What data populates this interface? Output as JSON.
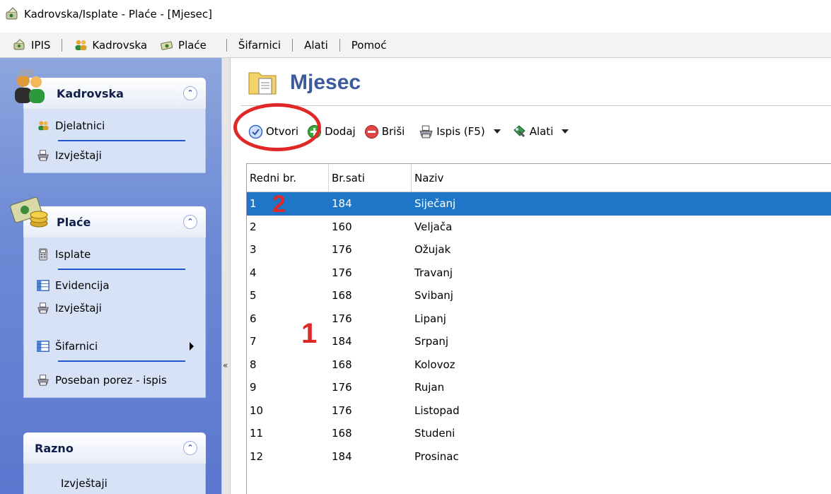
{
  "window": {
    "title": "Kadrovska/Isplate - Plaće - [Mjesec]"
  },
  "menu": {
    "items": [
      {
        "label": "IPIS",
        "icon": "ipis-icon"
      },
      {
        "label": "Kadrovska",
        "icon": "users-icon"
      },
      {
        "label": "Plaće",
        "icon": "money-icon"
      },
      {
        "label": "Šifarnici"
      },
      {
        "label": "Alati"
      },
      {
        "label": "Pomoć"
      }
    ]
  },
  "sidebar": {
    "groups": [
      {
        "title": "Kadrovska",
        "icon": "users-group-icon",
        "items": [
          {
            "label": "Djelatnici",
            "icon": "users-icon"
          },
          {
            "label": "Izvještaji",
            "icon": "printer-icon"
          }
        ]
      },
      {
        "title": "Plaće",
        "icon": "money-coins-icon",
        "items": [
          {
            "label": "Isplate",
            "icon": "calculator-icon"
          },
          {
            "label": "Evidencija",
            "icon": "table-icon"
          },
          {
            "label": "Izvještaji",
            "icon": "printer-icon"
          },
          {
            "label": "Šifarnici",
            "icon": "table-icon"
          },
          {
            "label": "Poseban porez - ispis",
            "icon": "printer-icon"
          }
        ]
      },
      {
        "title": "Razno",
        "items": [
          {
            "label": "Izvještaji"
          }
        ]
      }
    ]
  },
  "page": {
    "title": "Mjesec"
  },
  "toolbar": {
    "open_label": "Otvori",
    "add_label": "Dodaj",
    "delete_label": "Briši",
    "print_label": "Ispis (F5)",
    "tools_label": "Alati"
  },
  "grid": {
    "headers": [
      "Redni br.",
      "Br.sati",
      "Naziv"
    ],
    "selected_index": 0,
    "rows": [
      [
        "1",
        "184",
        "Siječanj"
      ],
      [
        "2",
        "160",
        "Veljača"
      ],
      [
        "3",
        "176",
        "Ožujak"
      ],
      [
        "4",
        "176",
        "Travanj"
      ],
      [
        "5",
        "168",
        "Svibanj"
      ],
      [
        "6",
        "176",
        "Lipanj"
      ],
      [
        "7",
        "184",
        "Srpanj"
      ],
      [
        "8",
        "168",
        "Kolovoz"
      ],
      [
        "9",
        "176",
        "Rujan"
      ],
      [
        "10",
        "176",
        "Listopad"
      ],
      [
        "11",
        "168",
        "Studeni"
      ],
      [
        "12",
        "184",
        "Prosinac"
      ]
    ]
  },
  "annotations": {
    "marker_1": "1",
    "marker_2": "2"
  },
  "colors": {
    "selection": "#1e76c8",
    "title_text": "#3b5b9c",
    "annotation": "#e02828"
  }
}
